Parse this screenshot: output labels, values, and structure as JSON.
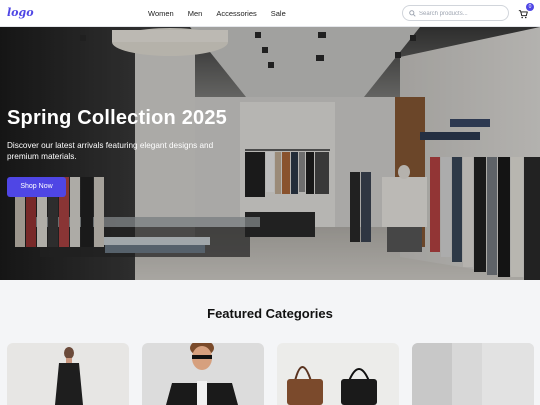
{
  "header": {
    "logo": "logo",
    "nav": [
      "Women",
      "Men",
      "Accessories",
      "Sale"
    ],
    "search_placeholder": "Search products...",
    "cart_count": "0"
  },
  "hero": {
    "title": "Spring Collection 2025",
    "subtitle": "Discover our latest arrivals featuring elegant designs and premium materials.",
    "button": "Shop Now"
  },
  "featured": {
    "title": "Featured Categories"
  },
  "colors": {
    "accent": "#4f46e5"
  }
}
